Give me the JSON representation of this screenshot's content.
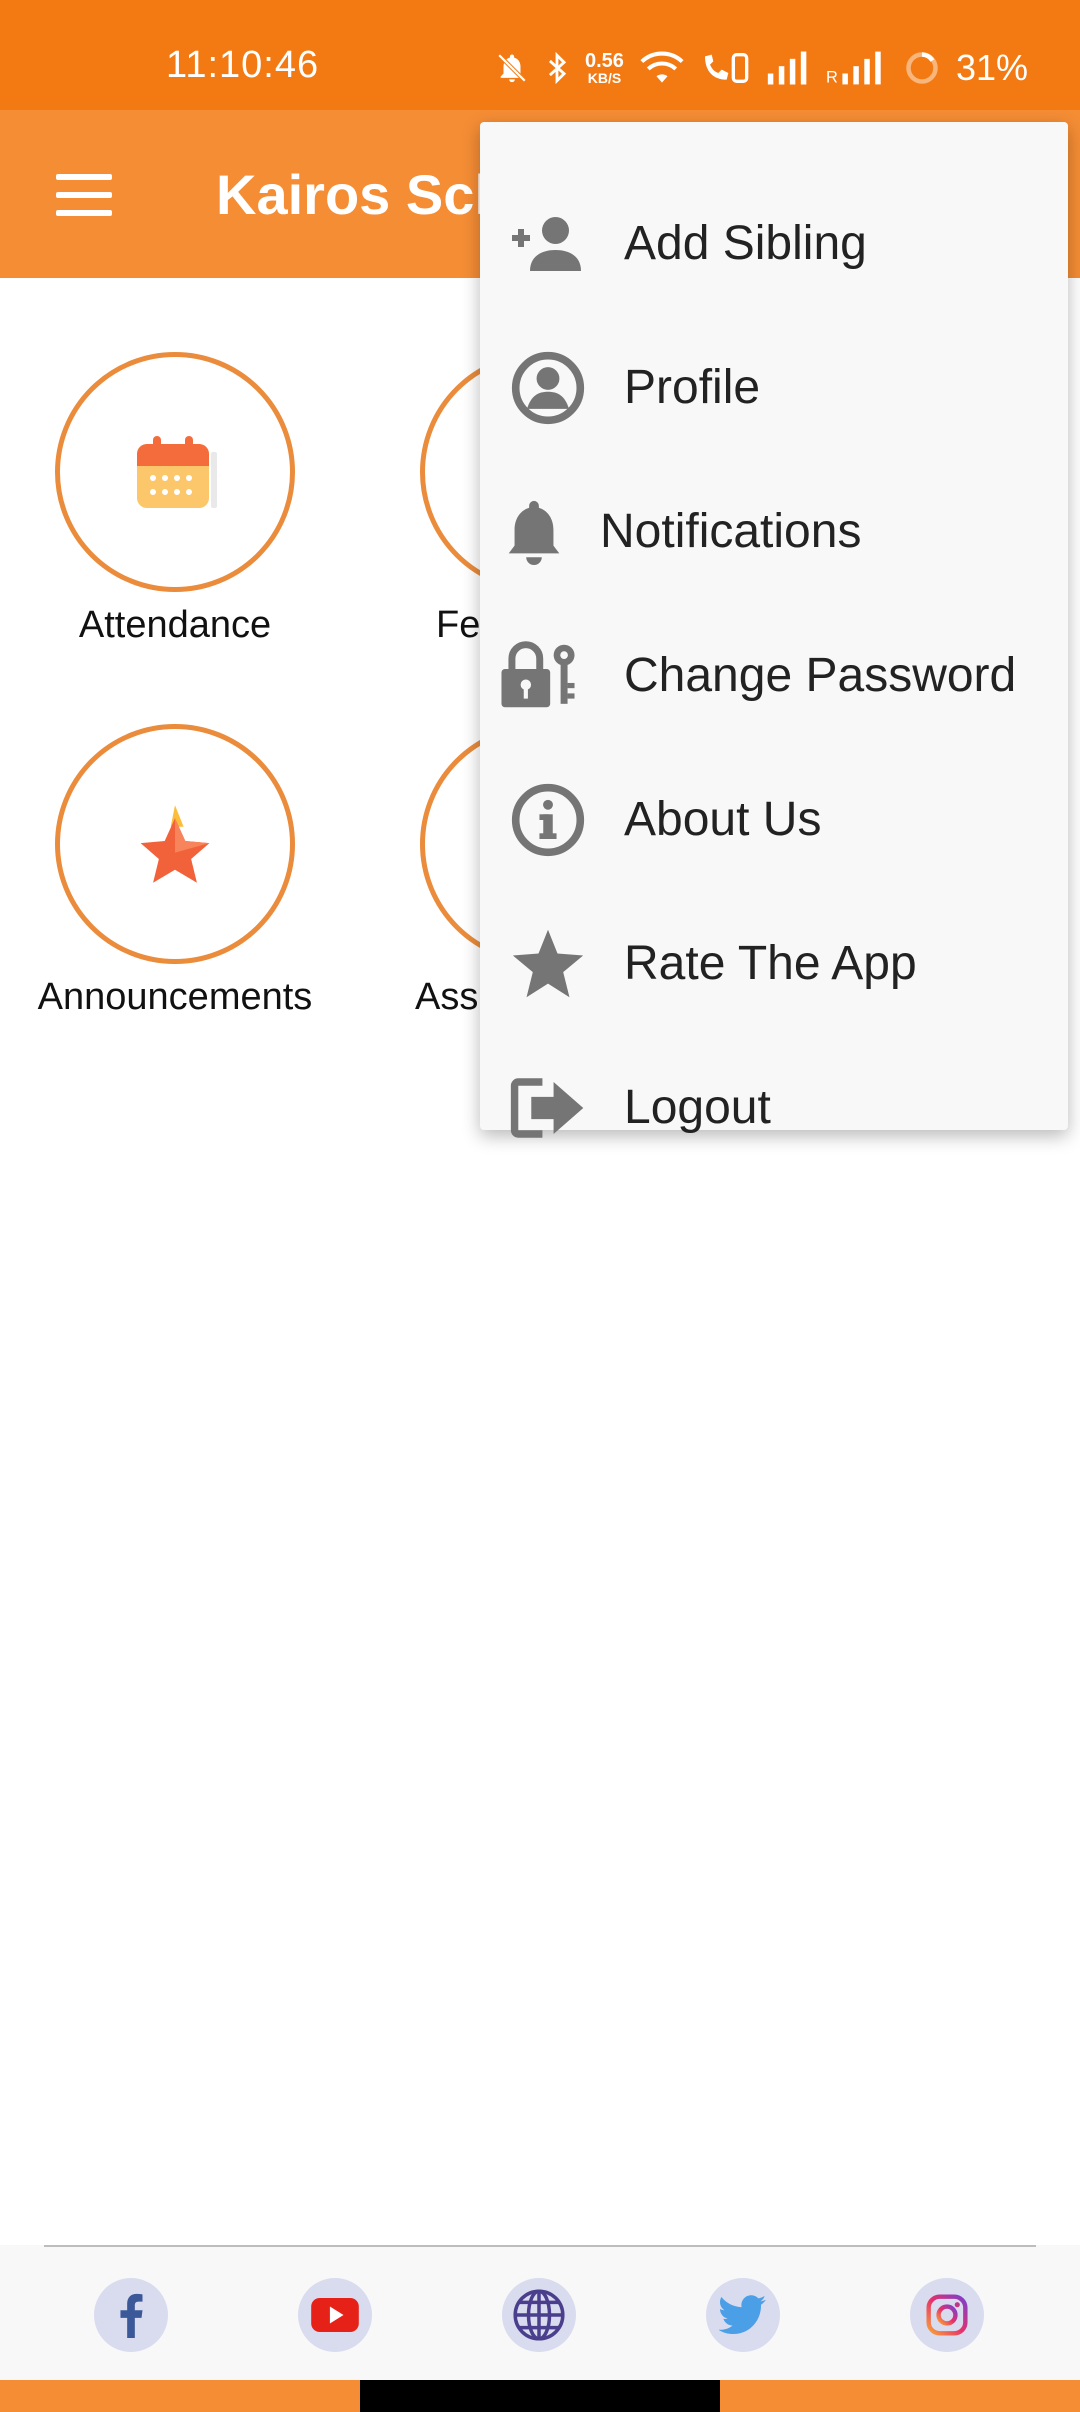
{
  "status": {
    "time": "11:10:46",
    "speed_value": "0.56",
    "speed_unit": "KB/S",
    "battery": "31%",
    "icons": [
      "mute-icon",
      "bluetooth-icon",
      "wifi-icon",
      "volte-icon",
      "signal-icon",
      "signal-roaming-icon",
      "battery-icon"
    ]
  },
  "app_bar": {
    "title": "Kairos Sch"
  },
  "grid": {
    "tiles": [
      {
        "label": "Attendance",
        "icon": "calendar-icon"
      },
      {
        "label": "Fe",
        "icon": ""
      },
      {
        "label": "Announcements",
        "icon": "star-icon"
      },
      {
        "label": "Ass",
        "icon": ""
      }
    ]
  },
  "menu": {
    "items": [
      {
        "label": "Add Sibling",
        "icon": "add-person-icon"
      },
      {
        "label": "Profile",
        "icon": "profile-icon"
      },
      {
        "label": "Notifications",
        "icon": "bell-icon"
      },
      {
        "label": "Change Password",
        "icon": "lock-key-icon"
      },
      {
        "label": "About Us",
        "icon": "info-icon"
      },
      {
        "label": "Rate The App",
        "icon": "star-icon"
      },
      {
        "label": "Logout",
        "icon": "logout-icon"
      }
    ]
  },
  "footer": {
    "links": [
      "facebook-icon",
      "youtube-icon",
      "globe-icon",
      "twitter-icon",
      "instagram-icon"
    ]
  },
  "colors": {
    "status_bar": "#f37a12",
    "app_bar": "#f58d35",
    "tile_border": "#ea8c3b",
    "menu_icon": "#757575"
  }
}
